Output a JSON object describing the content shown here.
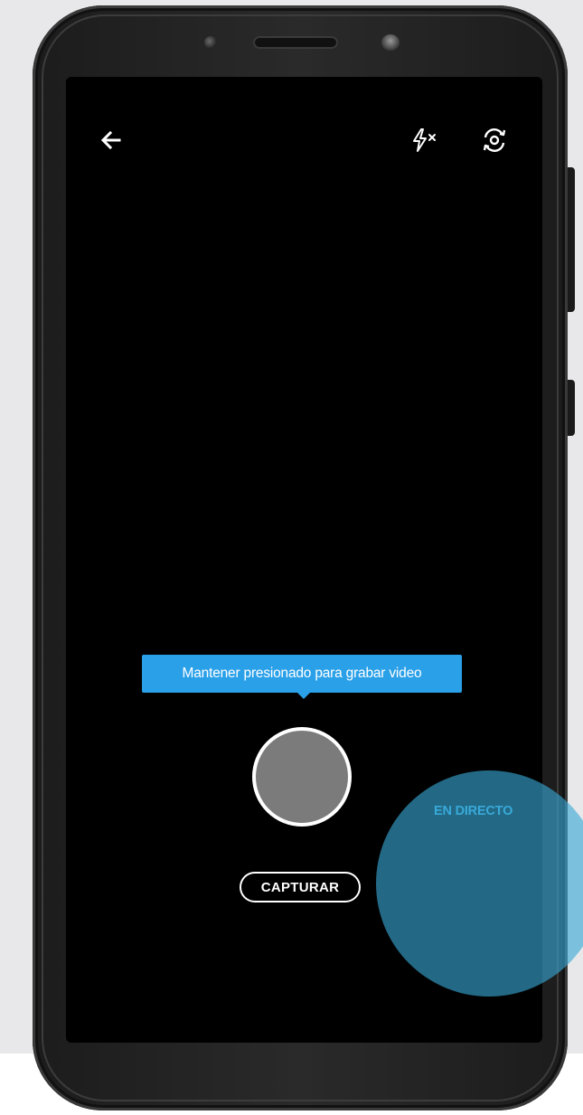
{
  "camera": {
    "tooltip": "Mantener presionado para grabar video",
    "modes": {
      "capture_label": "CAPTURAR",
      "live_label": "EN DIRECTO"
    },
    "icons": {
      "back": "arrow-left-icon",
      "flash": "flash-off-icon",
      "flip": "camera-flip-icon"
    }
  },
  "colors": {
    "tooltip_bg": "#2aa0e8",
    "highlight": "#38a9d9",
    "shutter_fill": "#7b7b7b",
    "screen_bg": "#000000",
    "page_bg": "#e8e8ea"
  }
}
